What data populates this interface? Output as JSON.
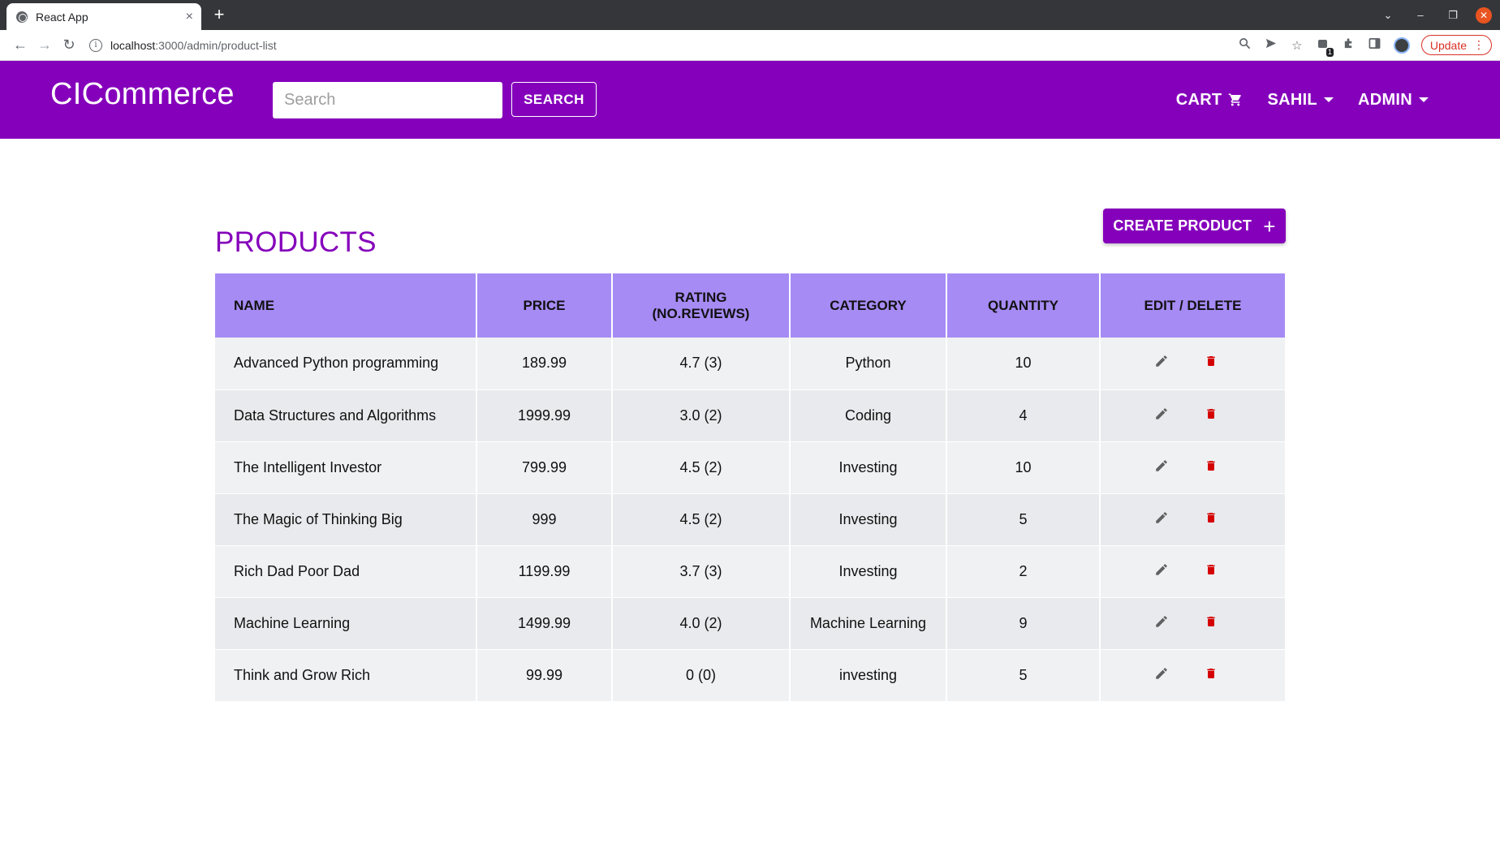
{
  "browser": {
    "tab_title": "React App",
    "tab_close": "×",
    "new_tab": "+",
    "url_host": "localhost",
    "url_path": ":3000/admin/product-list",
    "update_label": "Update",
    "extension_badge": "1"
  },
  "header": {
    "brand": "CICommerce",
    "search_placeholder": "Search",
    "search_button": "SEARCH",
    "cart_label": "CART",
    "user_label": "SAHIL",
    "admin_label": "ADMIN"
  },
  "page": {
    "title": "PRODUCTS",
    "create_button": "CREATE PRODUCT",
    "create_icon": "+"
  },
  "table": {
    "headers": {
      "name": "NAME",
      "price": "PRICE",
      "rating_line1": "RATING",
      "rating_line2": "(NO.REVIEWS)",
      "category": "CATEGORY",
      "quantity": "QUANTITY",
      "actions": "EDIT / DELETE"
    },
    "rows": [
      {
        "name": "Advanced Python programming",
        "price": "189.99",
        "rating": "4.7 (3)",
        "category": "Python",
        "quantity": "10"
      },
      {
        "name": "Data Structures and Algorithms",
        "price": "1999.99",
        "rating": "3.0 (2)",
        "category": "Coding",
        "quantity": "4"
      },
      {
        "name": "The Intelligent Investor",
        "price": "799.99",
        "rating": "4.5 (2)",
        "category": "Investing",
        "quantity": "10"
      },
      {
        "name": "The Magic of Thinking Big",
        "price": "999",
        "rating": "4.5 (2)",
        "category": "Investing",
        "quantity": "5"
      },
      {
        "name": "Rich Dad Poor Dad",
        "price": "1199.99",
        "rating": "3.7 (3)",
        "category": "Investing",
        "quantity": "2"
      },
      {
        "name": "Machine Learning",
        "price": "1499.99",
        "rating": "4.0 (2)",
        "category": "Machine Learning",
        "quantity": "9"
      },
      {
        "name": "Think and Grow Rich",
        "price": "99.99",
        "rating": "0 (0)",
        "category": "investing",
        "quantity": "5"
      }
    ]
  },
  "colors": {
    "brand": "#8500bb",
    "table_header": "#a68bf5",
    "delete_icon": "#d50000",
    "edit_icon": "#616161"
  },
  "icons": {
    "edit": "pencil-icon",
    "delete": "trash-icon",
    "cart": "shopping-cart-icon"
  }
}
